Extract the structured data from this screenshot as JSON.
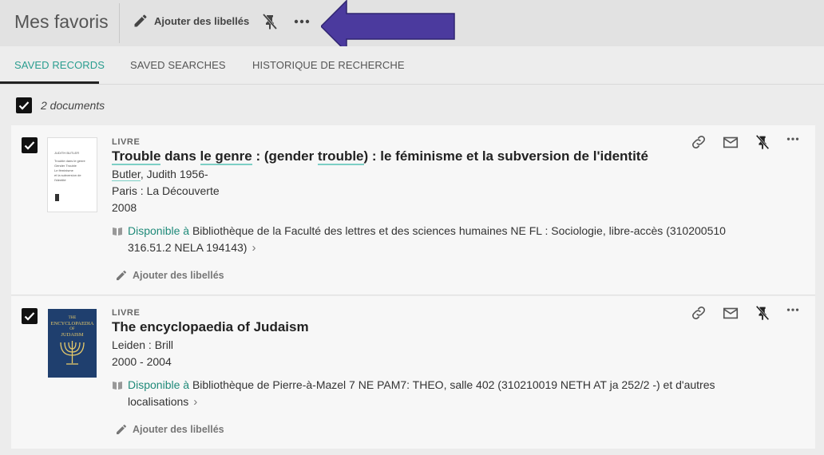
{
  "header": {
    "title": "Mes favoris",
    "add_labels": "Ajouter des libellés"
  },
  "tabs": [
    {
      "label": "SAVED RECORDS",
      "active": true
    },
    {
      "label": "SAVED SEARCHES",
      "active": false
    },
    {
      "label": "HISTORIQUE DE RECHERCHE",
      "active": false
    }
  ],
  "selection": {
    "count_label": "2 documents",
    "checked": true
  },
  "colors": {
    "accent": "#2a9d8f",
    "annotation_arrow": "#4b3a9e"
  },
  "records": [
    {
      "type": "LIVRE",
      "title_parts": [
        "Trouble",
        " dans ",
        "le genre",
        " : (gender ",
        "trouble",
        ") : le féminisme et la subversion de l'identité"
      ],
      "author": "Butler",
      "author_rest": ", Judith 1956-",
      "publisher": "Paris : La Découverte",
      "date": "2008",
      "availability_status": "Disponible à",
      "availability_line1": " Bibliothèque de la Faculté des lettres et des sciences humaines  NE FL : Sociologie, libre-accès (310200510",
      "availability_line2": "316.51.2 NELA 194143)",
      "add_labels": "Ajouter des libellés",
      "cover_lines": [
        "JUDITH BUTLER",
        "Trouble dans le genre",
        "Gender Trouble",
        "Le féminisme",
        "et la subversion de l'identité"
      ]
    },
    {
      "type": "LIVRE",
      "title": "The encyclopaedia of Judaism",
      "publisher": "Leiden : Brill",
      "date": "2000 - 2004",
      "availability_status": "Disponible à",
      "availability_line1": " Bibliothèque de Pierre-à-Mazel 7  NE PAM7: THEO, salle 402 (310210019 NETH AT ja 252/2 -) et d'autres",
      "availability_line2": "localisations",
      "add_labels": "Ajouter des libellés",
      "cover_lines": [
        "THE",
        "ENCYCLOPAEDIA",
        "OF",
        "JUDAISM"
      ]
    }
  ]
}
